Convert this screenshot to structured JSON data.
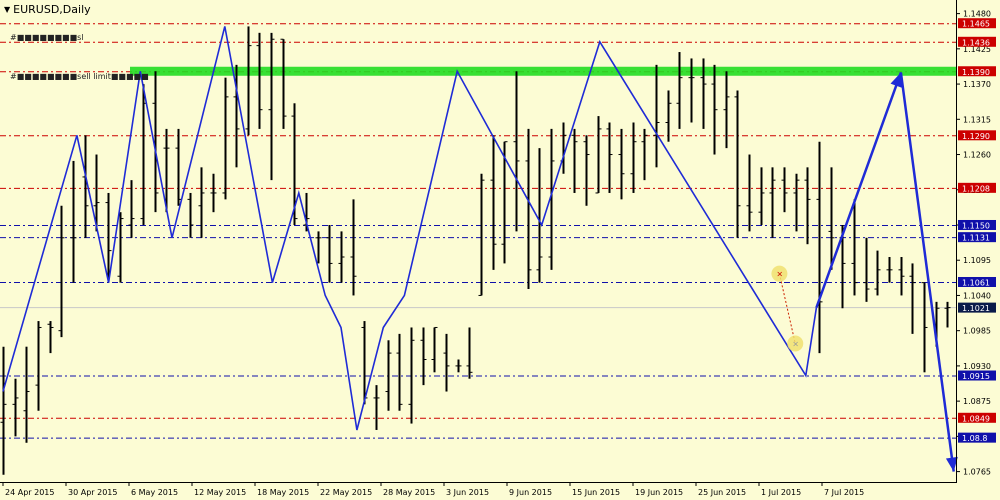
{
  "window": {
    "title": "EURUSD,Daily",
    "menu_arrow": "triangle-down-icon"
  },
  "colors": {
    "background": "#fcfcd4",
    "bar": "#000000",
    "zigzag": "#1f2bd6",
    "red_level": "#cc0000",
    "blue_level": "#1010aa",
    "green_band": "#22dd22",
    "bid_label": "#0a1a4a"
  },
  "order_labels": [
    {
      "id": "sl",
      "text": "#■■■■■■■■sl"
    },
    {
      "id": "sell-limit",
      "text": "#■■■■■■■■sell limit■■■■■"
    }
  ],
  "price_scale": [
    "1.1480",
    "1.1425",
    "1.1370",
    "1.1315",
    "1.1260",
    "1.1205",
    "1.1150",
    "1.1095",
    "1.1040",
    "1.0985",
    "1.0930",
    "1.0875",
    "1.0820",
    "1.0765"
  ],
  "level_labels": [
    {
      "price": 1.1465,
      "text": "1.1465",
      "kind": "red"
    },
    {
      "price": 1.1436,
      "text": "1.1436",
      "kind": "red"
    },
    {
      "price": 1.139,
      "text": "1.1390",
      "kind": "red"
    },
    {
      "price": 1.129,
      "text": "1.1290",
      "kind": "red"
    },
    {
      "price": 1.1208,
      "text": "1.1208",
      "kind": "red"
    },
    {
      "price": 1.115,
      "text": "1.1150",
      "kind": "blue"
    },
    {
      "price": 1.1131,
      "text": "1.1131",
      "kind": "blue"
    },
    {
      "price": 1.1061,
      "text": "1.1061",
      "kind": "blue"
    },
    {
      "price": 1.1021,
      "text": "1.1021",
      "kind": "bid"
    },
    {
      "price": 1.0915,
      "text": "1.0915",
      "kind": "blue"
    },
    {
      "price": 1.0849,
      "text": "1.0849",
      "kind": "red"
    },
    {
      "price": 1.0818,
      "text": "1.08.8",
      "kind": "blue"
    }
  ],
  "time_scale": [
    "24 Apr 2015",
    "30 Apr 2015",
    "6 May 2015",
    "12 May 2015",
    "18 May 2015",
    "22 May 2015",
    "28 May 2015",
    "3 Jun 2015",
    "9 Jun 2015",
    "15 Jun 2015",
    "19 Jun 2015",
    "25 Jun 2015",
    "1 Jul 2015",
    "7 Jul 2015"
  ],
  "chart_data": {
    "type": "ohlc",
    "symbol": "EURUSD",
    "timeframe": "Daily",
    "ylim": [
      1.0755,
      1.1495
    ],
    "ohlc": [
      [
        1.0842,
        1.096,
        1.076,
        1.087
      ],
      [
        1.087,
        1.091,
        1.082,
        1.088
      ],
      [
        1.086,
        1.096,
        1.081,
        1.089
      ],
      [
        1.09,
        1.1,
        1.086,
        1.099
      ],
      [
        1.0995,
        1.1,
        1.095,
        1.099
      ],
      [
        1.0985,
        1.118,
        1.0975,
        1.113
      ],
      [
        1.113,
        1.125,
        1.106,
        1.113
      ],
      [
        1.1225,
        1.129,
        1.113,
        1.118
      ],
      [
        1.118,
        1.126,
        1.114,
        1.1185
      ],
      [
        1.1185,
        1.12,
        1.106,
        1.111
      ],
      [
        1.107,
        1.117,
        1.106,
        1.116
      ],
      [
        1.115,
        1.122,
        1.113,
        1.116
      ],
      [
        1.116,
        1.137,
        1.115,
        1.134
      ],
      [
        1.134,
        1.139,
        1.117,
        1.12
      ],
      [
        1.127,
        1.13,
        1.117,
        1.127
      ],
      [
        1.127,
        1.13,
        1.118,
        1.119
      ],
      [
        1.119,
        1.12,
        1.113,
        1.115
      ],
      [
        1.118,
        1.124,
        1.113,
        1.12
      ],
      [
        1.12,
        1.123,
        1.117,
        1.12
      ],
      [
        1.12,
        1.138,
        1.119,
        1.135
      ],
      [
        1.135,
        1.14,
        1.124,
        1.13
      ],
      [
        1.13,
        1.146,
        1.129,
        1.143
      ],
      [
        1.143,
        1.145,
        1.13,
        1.133
      ],
      [
        1.133,
        1.145,
        1.122,
        1.144
      ],
      [
        1.144,
        1.144,
        1.13,
        1.132
      ],
      [
        1.132,
        1.134,
        1.115,
        1.116
      ],
      [
        1.115,
        1.12,
        1.114,
        1.116
      ],
      [
        1.113,
        1.114,
        1.109,
        1.113
      ],
      [
        1.113,
        1.115,
        1.106,
        1.109
      ],
      [
        1.109,
        1.114,
        1.106,
        1.11
      ],
      [
        1.11,
        1.119,
        1.104,
        1.107
      ],
      [
        1.099,
        1.1,
        1.087,
        1.088
      ],
      [
        1.088,
        1.09,
        1.083,
        1.088
      ],
      [
        1.089,
        1.097,
        1.086,
        1.095
      ],
      [
        1.095,
        1.098,
        1.086,
        1.087
      ],
      [
        1.087,
        1.099,
        1.084,
        1.097
      ],
      [
        1.097,
        1.099,
        1.09,
        1.094
      ],
      [
        1.094,
        1.099,
        1.092,
        1.099
      ],
      [
        1.095,
        1.098,
        1.089,
        1.093
      ],
      [
        1.093,
        1.094,
        1.092,
        1.093
      ],
      [
        1.093,
        1.099,
        1.091,
        1.092
      ],
      [
        1.104,
        1.123,
        1.104,
        1.122
      ],
      [
        1.122,
        1.129,
        1.108,
        1.112
      ],
      [
        1.112,
        1.128,
        1.109,
        1.128
      ],
      [
        1.128,
        1.139,
        1.114,
        1.125
      ],
      [
        1.125,
        1.13,
        1.105,
        1.108
      ],
      [
        1.108,
        1.127,
        1.106,
        1.11
      ],
      [
        1.11,
        1.13,
        1.108,
        1.125
      ],
      [
        1.125,
        1.131,
        1.123,
        1.129
      ],
      [
        1.129,
        1.13,
        1.12,
        1.128
      ],
      [
        1.128,
        1.129,
        1.118,
        1.126
      ],
      [
        1.12,
        1.132,
        1.12,
        1.13
      ],
      [
        1.13,
        1.131,
        1.12,
        1.126
      ],
      [
        1.126,
        1.13,
        1.119,
        1.123
      ],
      [
        1.123,
        1.131,
        1.12,
        1.128
      ],
      [
        1.128,
        1.13,
        1.122,
        1.129
      ],
      [
        1.129,
        1.14,
        1.124,
        1.131
      ],
      [
        1.131,
        1.136,
        1.128,
        1.134
      ],
      [
        1.134,
        1.142,
        1.13,
        1.138
      ],
      [
        1.138,
        1.141,
        1.131,
        1.138
      ],
      [
        1.138,
        1.141,
        1.13,
        1.137
      ],
      [
        1.137,
        1.14,
        1.126,
        1.133
      ],
      [
        1.133,
        1.139,
        1.127,
        1.135
      ],
      [
        1.135,
        1.136,
        1.113,
        1.118
      ],
      [
        1.118,
        1.126,
        1.114,
        1.117
      ],
      [
        1.117,
        1.124,
        1.115,
        1.12
      ],
      [
        1.12,
        1.124,
        1.113,
        1.122
      ],
      [
        1.122,
        1.124,
        1.117,
        1.12
      ],
      [
        1.12,
        1.123,
        1.114,
        1.122
      ],
      [
        1.122,
        1.124,
        1.112,
        1.119
      ],
      [
        1.119,
        1.128,
        1.095,
        1.103
      ],
      [
        1.114,
        1.124,
        1.108,
        1.113
      ],
      [
        1.113,
        1.115,
        1.102,
        1.109
      ],
      [
        1.109,
        1.119,
        1.104,
        1.106
      ],
      [
        1.106,
        1.113,
        1.103,
        1.105
      ],
      [
        1.105,
        1.111,
        1.104,
        1.108
      ],
      [
        1.108,
        1.11,
        1.106,
        1.108
      ],
      [
        1.108,
        1.11,
        1.104,
        1.107
      ],
      [
        1.107,
        1.109,
        1.098,
        1.106
      ],
      [
        1.106,
        1.106,
        1.092,
        1.099
      ],
      [
        1.099,
        1.103,
        1.096,
        1.102
      ],
      [
        1.102,
        1.103,
        1.099,
        1.1021
      ]
    ],
    "zigzag": [
      {
        "bar": 0,
        "price": 1.089
      },
      {
        "bar": 14,
        "price": 1.129
      },
      {
        "bar": 20,
        "price": 1.106
      },
      {
        "bar": 26,
        "price": 1.139
      },
      {
        "bar": 32,
        "price": 1.113
      },
      {
        "bar": 42,
        "price": 1.146
      },
      {
        "bar": 51,
        "price": 1.106
      },
      {
        "bar": 56,
        "price": 1.12
      },
      {
        "bar": 61,
        "price": 1.104
      },
      {
        "bar": 64,
        "price": 1.099
      },
      {
        "bar": 67,
        "price": 1.083
      },
      {
        "bar": 72,
        "price": 1.099
      },
      {
        "bar": 76,
        "price": 1.104
      },
      {
        "bar": 86,
        "price": 1.139
      },
      {
        "bar": 102,
        "price": 1.115
      },
      {
        "bar": 113,
        "price": 1.1436
      },
      {
        "bar": 152,
        "price": 1.0915
      },
      {
        "bar": 154,
        "price": 1.1021
      },
      {
        "bar": 170,
        "price": 1.1388
      },
      {
        "bar": 180,
        "price": 1.0765
      }
    ],
    "trade_marks": [
      {
        "bar": 147,
        "price": 1.1074,
        "kind": "entry"
      },
      {
        "bar": 150,
        "price": 1.0965,
        "kind": "exit"
      }
    ]
  }
}
